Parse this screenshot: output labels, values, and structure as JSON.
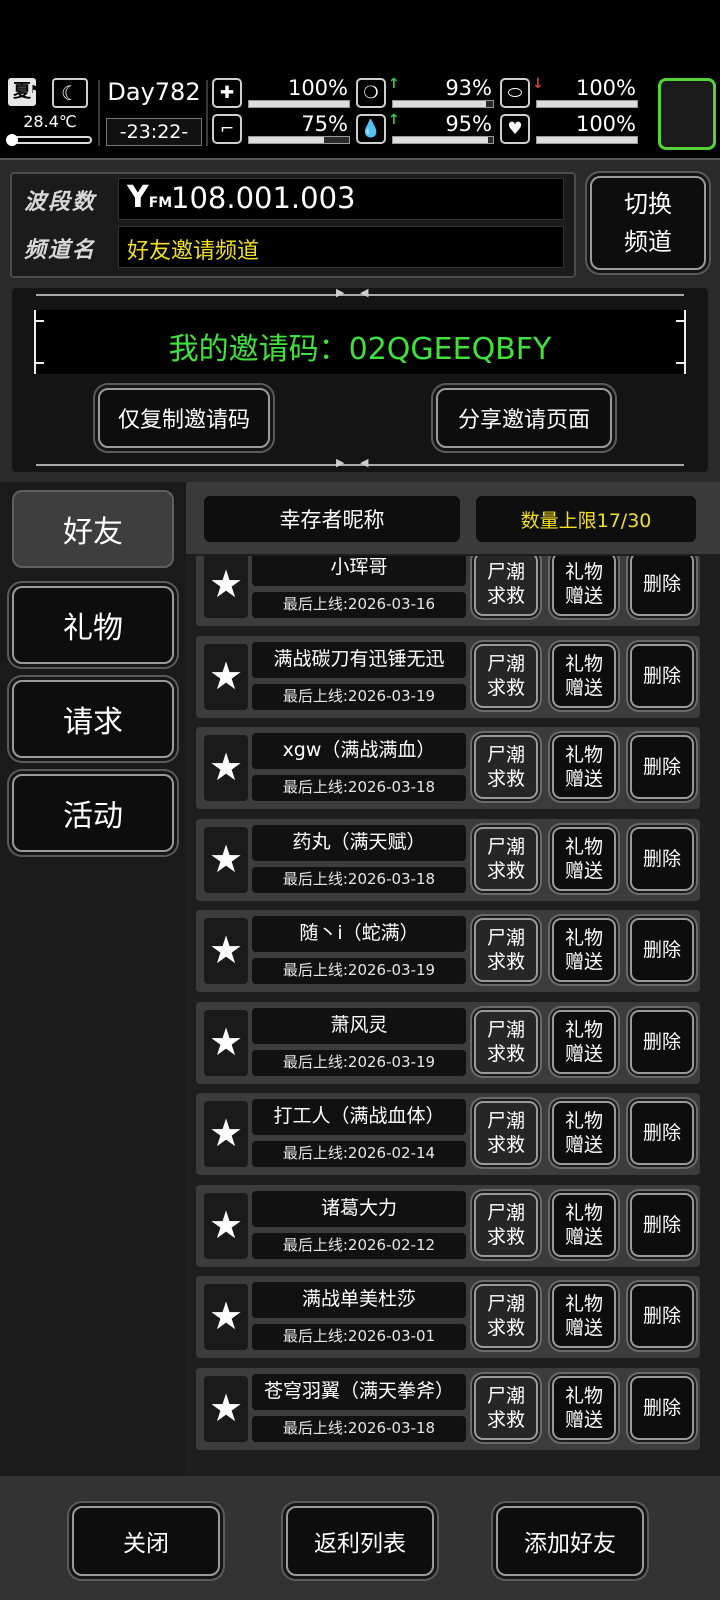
{
  "status": {
    "season": "夏",
    "temperature": "28.4℃",
    "day": "Day782",
    "time": "-23:22-",
    "stats": [
      {
        "name": "health",
        "icon": "medkit-icon",
        "value": "100%",
        "level": 100,
        "trend": ""
      },
      {
        "name": "hunger",
        "icon": "stomach-icon",
        "value": "93%",
        "level": 93,
        "trend": "up"
      },
      {
        "name": "energy",
        "icon": "pill-icon",
        "value": "100%",
        "level": 100,
        "trend": "down"
      },
      {
        "name": "stamina",
        "icon": "boot-icon",
        "value": "75%",
        "level": 75,
        "trend": ""
      },
      {
        "name": "thirst",
        "icon": "water-drop-icon",
        "value": "95%",
        "level": 95,
        "trend": "up"
      },
      {
        "name": "mood",
        "icon": "heart-icon",
        "value": "100%",
        "level": 100,
        "trend": ""
      }
    ]
  },
  "radio": {
    "band_label": "波段数",
    "band_value": "108.001.003",
    "channel_label": "频道名",
    "channel_value": "好友邀请频道",
    "switch_label_1": "切换",
    "switch_label_2": "频道"
  },
  "invite": {
    "code_text": "我的邀请码：02QGEEQBFY",
    "copy_button": "仅复制邀请码",
    "share_button": "分享邀请页面"
  },
  "tabs": [
    {
      "label": "好友",
      "active": true
    },
    {
      "label": "礼物",
      "active": false
    },
    {
      "label": "请求",
      "active": false
    },
    {
      "label": "活动",
      "active": false
    }
  ],
  "friends_header": {
    "name_col": "幸存者昵称",
    "limit": "数量上限17/30"
  },
  "row_buttons": {
    "help_1": "尸潮",
    "help_2": "求救",
    "gift_1": "礼物",
    "gift_2": "赠送",
    "delete": "删除"
  },
  "friends": [
    {
      "name": "小珲哥",
      "last_online": "最后上线:2026-03-16"
    },
    {
      "name": "满战碳刀有迅锤无迅",
      "last_online": "最后上线:2026-03-19"
    },
    {
      "name": "xgw（满战满血）",
      "last_online": "最后上线:2026-03-18"
    },
    {
      "name": "药丸（满天赋）",
      "last_online": "最后上线:2026-03-18"
    },
    {
      "name": "随丶i（蛇满）",
      "last_online": "最后上线:2026-03-19"
    },
    {
      "name": "萧风灵",
      "last_online": "最后上线:2026-03-19"
    },
    {
      "name": "打工人（满战血体）",
      "last_online": "最后上线:2026-02-14"
    },
    {
      "name": "诸葛大力",
      "last_online": "最后上线:2026-02-12"
    },
    {
      "name": "满战单美杜莎",
      "last_online": "最后上线:2026-03-01"
    },
    {
      "name": "苍穹羽翼（满天拳斧）",
      "last_online": "最后上线:2026-03-18"
    }
  ],
  "bottom": {
    "close": "关闭",
    "rebate": "返利列表",
    "add_friend": "添加好友"
  },
  "colors": {
    "accent_green": "#3fe23a",
    "accent_yellow": "#f0e020",
    "frame_green": "#55d13a"
  }
}
